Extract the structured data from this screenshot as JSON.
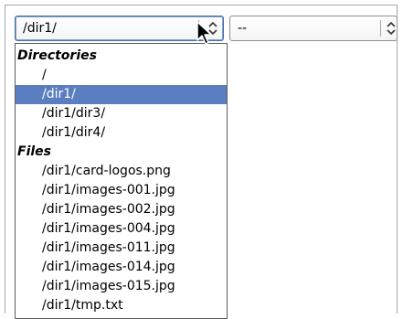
{
  "primary_select": {
    "value": "/dir1/"
  },
  "secondary_select": {
    "value": "--"
  },
  "dropdown": {
    "groups": [
      {
        "label": "Directories",
        "options": [
          {
            "label": "/",
            "selected": false
          },
          {
            "label": "/dir1/",
            "selected": true
          },
          {
            "label": "/dir1/dir3/",
            "selected": false
          },
          {
            "label": "/dir1/dir4/",
            "selected": false
          }
        ]
      },
      {
        "label": "Files",
        "options": [
          {
            "label": "/dir1/card-logos.png",
            "selected": false
          },
          {
            "label": "/dir1/images-001.jpg",
            "selected": false
          },
          {
            "label": "/dir1/images-002.jpg",
            "selected": false
          },
          {
            "label": "/dir1/images-004.jpg",
            "selected": false
          },
          {
            "label": "/dir1/images-011.jpg",
            "selected": false
          },
          {
            "label": "/dir1/images-014.jpg",
            "selected": false
          },
          {
            "label": "/dir1/images-015.jpg",
            "selected": false
          },
          {
            "label": "/dir1/tmp.txt",
            "selected": false
          }
        ]
      }
    ]
  },
  "icons": {
    "select_arrows": "up-down-chevrons-icon",
    "cursor": "mouse-pointer-icon"
  },
  "colors": {
    "selected_background": "#5a7ec0",
    "selected_text": "#ffffff",
    "focus_border": "#4a6ea9"
  }
}
